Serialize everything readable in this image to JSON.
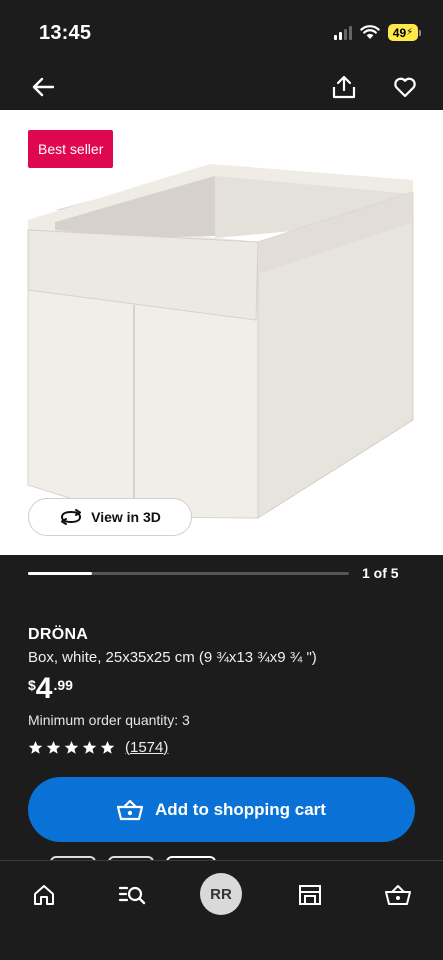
{
  "status": {
    "time": "13:45",
    "battery": "49"
  },
  "nav": {
    "back_icon": "arrow-left-icon",
    "share_icon": "share-icon",
    "favorite_icon": "heart-icon"
  },
  "image": {
    "badge": "Best seller",
    "view3d_label": "View in 3D"
  },
  "carousel": {
    "current": 1,
    "total": 5,
    "label": "1 of 5",
    "progress": 0.2
  },
  "product": {
    "name": "DRÖNA",
    "description": "Box, white, 25x35x25 cm (9 ¾x13 ¾x9 ¾ \")",
    "price": {
      "currency": "$",
      "integer": "4",
      "decimals": ".99"
    },
    "min_order": "Minimum order quantity: 3",
    "rating": {
      "stars": 5,
      "count": "1574"
    }
  },
  "actions": {
    "add_to_cart": "Add to shopping cart"
  },
  "tabbar": {
    "avatar_initials": "RR"
  },
  "colors": {
    "badge": "#e00751",
    "cart_button": "#0a72d6",
    "background": "#1c1c1c"
  }
}
